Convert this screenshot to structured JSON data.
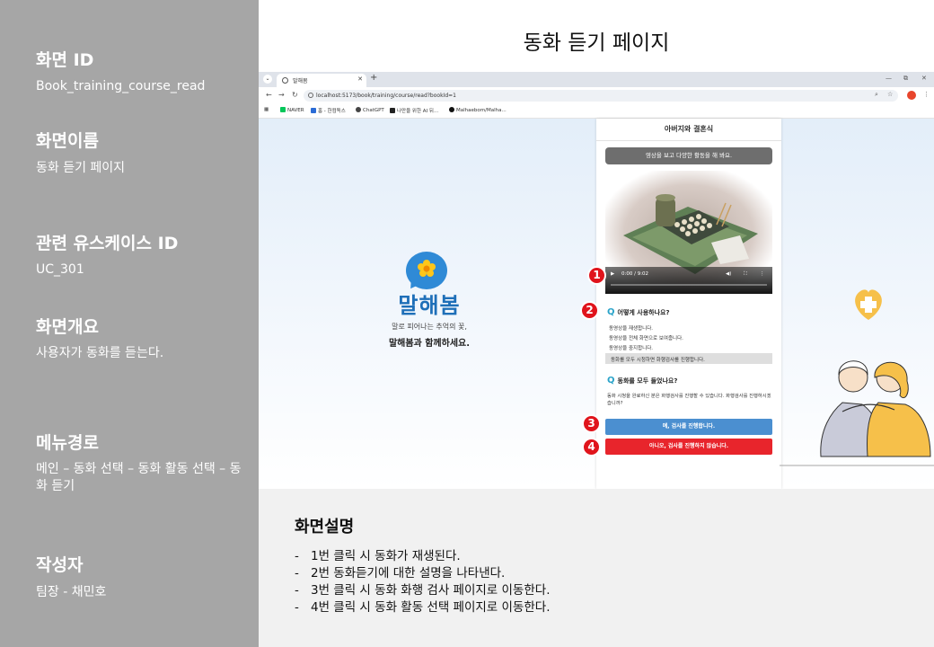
{
  "title": "동화 듣기 페이지",
  "meta": {
    "screen_id_label": "화면 ID",
    "screen_id": "Book_training_course_read",
    "screen_name_label": "화면이름",
    "screen_name": "동화 듣기 페이지",
    "usecase_label": "관련 유스케이스 ID",
    "usecase_id": "UC_301",
    "overview_label": "화면개요",
    "overview": "사용자가 동화를 듣는다.",
    "menu_label": "메뉴경로",
    "menu_path": "메인 – 동화 선택 – 동화 활동 선택 – 동화 듣기",
    "author_label": "작성자",
    "author": "팀장 - 채민호"
  },
  "browser": {
    "tab_title": "말해봄",
    "url": "localhost:5173/book/training/course/read?bookId=1",
    "bookmarks": [
      {
        "label": "NAVER",
        "color": "#03c75a"
      },
      {
        "label": "홈 - 한컴독스",
        "color": "#2b6cd6"
      },
      {
        "label": "ChatGPT",
        "color": "#444444"
      },
      {
        "label": "나만을 위한 AI 뒤...",
        "color": "#222222"
      },
      {
        "label": "Malhaebom/Malha...",
        "color": "#111111"
      }
    ]
  },
  "brand": {
    "name": "말해봄",
    "tagline1": "말로 피어나는 추억의 꽃,",
    "tagline2": "말해봄과 함께하세요."
  },
  "app": {
    "title": "아버지와 결혼식",
    "instruction": "영상을 보고 다양한 활동을 해 봐요.",
    "video": {
      "time": "0:00 / 9:02"
    },
    "q1": {
      "mark": "Q",
      "title": "어떻게 사용하나요?",
      "steps": [
        "동영상을 재생합니다.",
        "동영상을 전체 화면으로 보여줍니다.",
        "동영상을 중지합니다."
      ],
      "highlight": "동화를 모두 시청하면 화행검사를 진행합니다."
    },
    "q2": {
      "mark": "Q",
      "title": "동화를 모두 들었나요?",
      "text": "동화 시청을 완료하신 분은 화행검사를 진행할 수 있습니다. 화행검사를 진행하시겠습니까?"
    },
    "yes_button": "예, 검사를 진행합니다.",
    "no_button": "아니오, 검사를 진행하지 않습니다."
  },
  "markers": [
    "1",
    "2",
    "3",
    "4"
  ],
  "description": {
    "heading": "화면설명",
    "items": [
      "1번 클릭 시 동화가 재생된다.",
      "2번 동화듣기에 대한 설명을 나타낸다.",
      "3번 클릭 시 동화 화행 검사 페이지로 이동한다.",
      "4번 클릭 시 동화 활동 선택 페이지로 이동한다."
    ]
  },
  "colors": {
    "left_panel": "#a6a6a6",
    "brand_blue": "#1e6fb8",
    "yes_button": "#4b8fd0",
    "no_button": "#e8252c",
    "marker": "#e0141c"
  }
}
